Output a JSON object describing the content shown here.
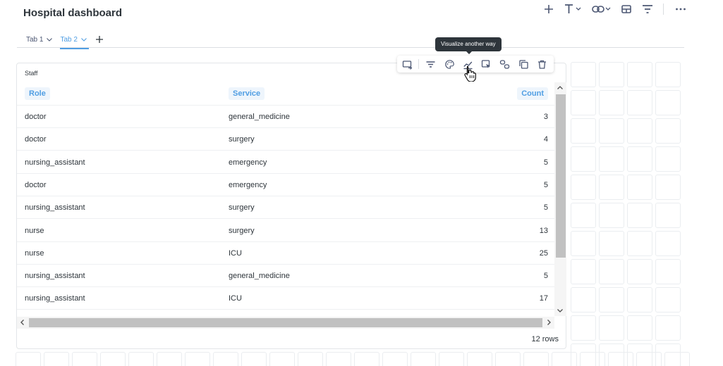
{
  "header": {
    "title": "Hospital dashboard",
    "toolbar": [
      {
        "name": "add-icon"
      },
      {
        "name": "text-icon"
      },
      {
        "name": "link-icon"
      },
      {
        "name": "section-icon"
      },
      {
        "name": "filter-icon"
      },
      {
        "name": "more-icon"
      }
    ]
  },
  "tabs": [
    {
      "label": "Tab 1",
      "active": false
    },
    {
      "label": "Tab 2",
      "active": true
    }
  ],
  "card": {
    "title": "Staff",
    "columns": [
      "Role",
      "Service",
      "Count"
    ],
    "rows": [
      [
        "doctor",
        "general_medicine",
        "3"
      ],
      [
        "doctor",
        "surgery",
        "4"
      ],
      [
        "nursing_assistant",
        "emergency",
        "5"
      ],
      [
        "doctor",
        "emergency",
        "5"
      ],
      [
        "nursing_assistant",
        "surgery",
        "5"
      ],
      [
        "nurse",
        "surgery",
        "13"
      ],
      [
        "nurse",
        "ICU",
        "25"
      ],
      [
        "nursing_assistant",
        "general_medicine",
        "5"
      ],
      [
        "nursing_assistant",
        "ICU",
        "17"
      ]
    ],
    "row_count": "12 rows"
  },
  "action_bar": {
    "buttons": [
      "replace-icon",
      "filter-icon",
      "palette-icon",
      "visualize-icon",
      "click-behavior-icon",
      "link-icon",
      "duplicate-icon",
      "trash-icon"
    ],
    "tooltip": "Visualize another way"
  },
  "colors": {
    "accent": "#509ee3",
    "text": "#2e353b",
    "tooltip_bg": "#2e353b"
  }
}
